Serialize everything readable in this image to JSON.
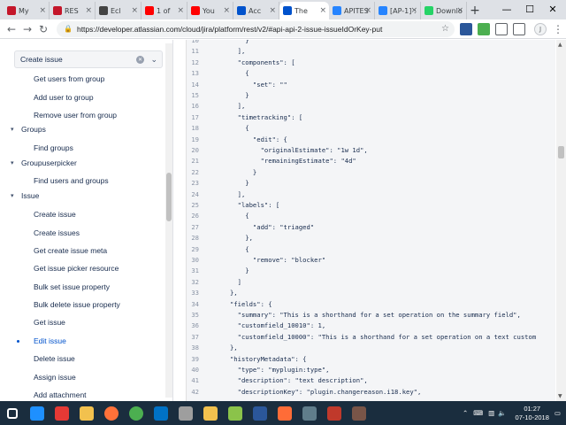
{
  "browser": {
    "tabs": [
      {
        "label": "My",
        "icon": "netflix-icon",
        "color": "#c4162a"
      },
      {
        "label": "RES",
        "icon": "netflix-icon",
        "color": "#c4162a"
      },
      {
        "label": "Ecl",
        "icon": "globe-icon",
        "color": "#444"
      },
      {
        "label": "1 of",
        "icon": "youtube-icon",
        "color": "#ff0000"
      },
      {
        "label": "You",
        "icon": "youtube-icon",
        "color": "#ff0000"
      },
      {
        "label": "Acc",
        "icon": "atlassian-icon",
        "color": "#0052cc"
      },
      {
        "label": "The",
        "icon": "atlassian-icon",
        "color": "#0052cc",
        "active": true
      },
      {
        "label": "APITES",
        "icon": "jira-icon",
        "color": "#2684ff"
      },
      {
        "label": "[AP-1] :",
        "icon": "jira-icon",
        "color": "#2684ff"
      },
      {
        "label": "Downlo",
        "icon": "whatsapp-icon",
        "color": "#25d366"
      }
    ],
    "url": "https://developer.atlassian.com/cloud/jira/platform/rest/v2/#api-api-2-issue-issueIdOrKey-put",
    "profile_initial": "J"
  },
  "sidebar": {
    "search_value": "Create issue",
    "items": [
      {
        "label": "Get users from group",
        "kind": "leaf"
      },
      {
        "label": "Add user to group",
        "kind": "leaf"
      },
      {
        "label": "Remove user from group",
        "kind": "leaf"
      },
      {
        "label": "Groups",
        "kind": "group"
      },
      {
        "label": "Find groups",
        "kind": "leaf"
      },
      {
        "label": "Groupuserpicker",
        "kind": "group"
      },
      {
        "label": "Find users and groups",
        "kind": "leaf"
      },
      {
        "label": "Issue",
        "kind": "group"
      },
      {
        "label": "Create issue",
        "kind": "leaf"
      },
      {
        "label": "Create issues",
        "kind": "leaf"
      },
      {
        "label": "Get create issue meta",
        "kind": "leaf"
      },
      {
        "label": "Get issue picker resource",
        "kind": "leaf"
      },
      {
        "label": "Bulk set issue property",
        "kind": "leaf"
      },
      {
        "label": "Bulk delete issue property",
        "kind": "leaf"
      },
      {
        "label": "Get issue",
        "kind": "leaf"
      },
      {
        "label": "Edit issue",
        "kind": "leaf",
        "active": true
      },
      {
        "label": "Delete issue",
        "kind": "leaf"
      },
      {
        "label": "Assign issue",
        "kind": "leaf"
      },
      {
        "label": "Add attachment",
        "kind": "leaf"
      }
    ]
  },
  "code": {
    "lines": [
      {
        "n": "10",
        "t": "          }"
      },
      {
        "n": "11",
        "t": "        ],"
      },
      {
        "n": "12",
        "t": "        \"components\": ["
      },
      {
        "n": "13",
        "t": "          {"
      },
      {
        "n": "14",
        "t": "            \"set\": \"\""
      },
      {
        "n": "15",
        "t": "          }"
      },
      {
        "n": "16",
        "t": "        ],"
      },
      {
        "n": "17",
        "t": "        \"timetracking\": ["
      },
      {
        "n": "18",
        "t": "          {"
      },
      {
        "n": "19",
        "t": "            \"edit\": {"
      },
      {
        "n": "20",
        "t": "              \"originalEstimate\": \"1w 1d\","
      },
      {
        "n": "21",
        "t": "              \"remainingEstimate\": \"4d\""
      },
      {
        "n": "22",
        "t": "            }"
      },
      {
        "n": "23",
        "t": "          }"
      },
      {
        "n": "24",
        "t": "        ],"
      },
      {
        "n": "25",
        "t": "        \"labels\": ["
      },
      {
        "n": "26",
        "t": "          {"
      },
      {
        "n": "27",
        "t": "            \"add\": \"triaged\""
      },
      {
        "n": "28",
        "t": "          },"
      },
      {
        "n": "29",
        "t": "          {"
      },
      {
        "n": "30",
        "t": "            \"remove\": \"blocker\""
      },
      {
        "n": "31",
        "t": "          }"
      },
      {
        "n": "32",
        "t": "        ]"
      },
      {
        "n": "33",
        "t": "      },"
      },
      {
        "n": "34",
        "t": "      \"fields\": {"
      },
      {
        "n": "35",
        "t": "        \"summary\": \"This is a shorthand for a set operation on the summary field\","
      },
      {
        "n": "36",
        "t": "        \"customfield_10010\": 1,"
      },
      {
        "n": "37",
        "t": "        \"customfield_10000\": \"This is a shorthand for a set operation on a text custom"
      },
      {
        "n": "38",
        "t": "      },"
      },
      {
        "n": "39",
        "t": "      \"historyMetadata\": {"
      },
      {
        "n": "40",
        "t": "        \"type\": \"myplugin:type\","
      },
      {
        "n": "41",
        "t": "        \"description\": \"text description\","
      },
      {
        "n": "42",
        "t": "        \"descriptionKey\": \"plugin.changereason.i18.key\","
      }
    ]
  },
  "taskbar": {
    "time": "01:27",
    "date": "07-10-2018",
    "apps": [
      {
        "icon": "windows-start-icon",
        "color": "#ffffff"
      },
      {
        "icon": "internet-explorer-icon",
        "color": "#1e90ff"
      },
      {
        "icon": "app-red-icon",
        "color": "#e53935"
      },
      {
        "icon": "file-explorer-icon",
        "color": "#f2c14e"
      },
      {
        "icon": "firefox-icon",
        "color": "#ff7139"
      },
      {
        "icon": "chrome-icon",
        "color": "#4caf50"
      },
      {
        "icon": "outlook-icon",
        "color": "#0072c6"
      },
      {
        "icon": "settings-icon",
        "color": "#9e9e9e"
      },
      {
        "icon": "folder-icon",
        "color": "#f2c14e"
      },
      {
        "icon": "notepad-icon",
        "color": "#8bc34a"
      },
      {
        "icon": "word-icon",
        "color": "#2b579a"
      },
      {
        "icon": "postman-icon",
        "color": "#ff6c37"
      },
      {
        "icon": "app-gray-icon",
        "color": "#607d8b"
      },
      {
        "icon": "photos-icon",
        "color": "#c0392b"
      },
      {
        "icon": "tool-icon",
        "color": "#795548"
      }
    ]
  }
}
